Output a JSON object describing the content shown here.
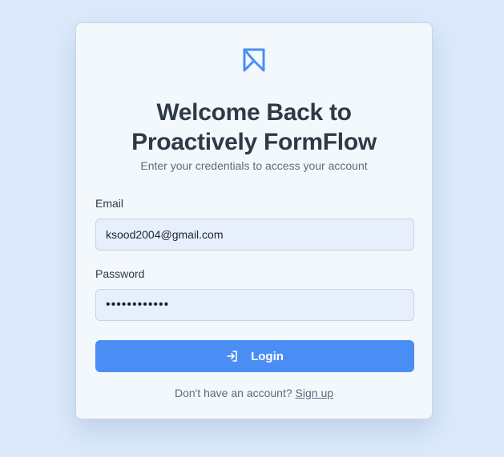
{
  "brand": {
    "logo_icon": "bookmark-logo-icon",
    "accent_color": "#4a8ef5"
  },
  "header": {
    "title_line1": "Welcome Back to",
    "title_line2": "Proactively FormFlow",
    "subtitle": "Enter your credentials to access your account"
  },
  "form": {
    "email_label": "Email",
    "email_value": "ksood2004@gmail.com",
    "password_label": "Password",
    "password_value": "••••••••••••",
    "login_label": "Login",
    "login_icon": "login-arrow-icon"
  },
  "footer": {
    "prompt": "Don't have an account?",
    "signup_label": "Sign up"
  }
}
